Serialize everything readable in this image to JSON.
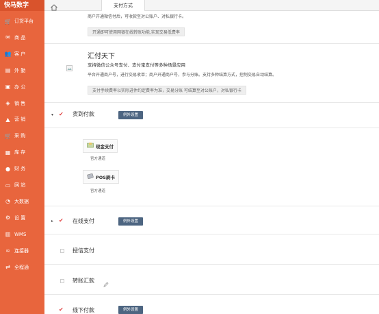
{
  "app": {
    "brand": "快马数字"
  },
  "sidebar": {
    "items": [
      {
        "label": "订货平台",
        "icon": "cart-icon"
      },
      {
        "label": "商 品",
        "icon": "mail-icon"
      },
      {
        "label": "客 户",
        "icon": "users-icon"
      },
      {
        "label": "外 勤",
        "icon": "document-icon"
      },
      {
        "label": "办 公",
        "icon": "briefcase-icon"
      },
      {
        "label": "销 售",
        "icon": "tag-icon"
      },
      {
        "label": "营 销",
        "icon": "chart-icon"
      },
      {
        "label": "采 购",
        "icon": "cart-icon"
      },
      {
        "label": "库 存",
        "icon": "box-icon"
      },
      {
        "label": "财 务",
        "icon": "money-bag-icon"
      },
      {
        "label": "网 站",
        "icon": "monitor-icon"
      },
      {
        "label": "大数据",
        "icon": "pie-chart-icon"
      },
      {
        "label": "设 置",
        "icon": "gear-icon"
      },
      {
        "label": "WMS",
        "icon": "warehouse-icon"
      },
      {
        "label": "连接器",
        "icon": "link-icon"
      },
      {
        "label": "全程通",
        "icon": "exchange-icon"
      }
    ]
  },
  "topbar": {
    "tab_label": "支付方式"
  },
  "top_section": {
    "desc": "商户开通微信付后，可收款至对公账户、对私银行卡。",
    "button": "开通即可使用网银在线转账功能,实现交易低费率"
  },
  "huifu": {
    "title": "汇付天下",
    "subtitle": "支持微信公众号支付、支付宝支付等多种场景应用",
    "desc": "平台开通商户号，进行交易收单；商户开通商户号，参与分账。支持多种结算方式，控制交易自动结算。",
    "button": "支付手续费率以实际进件约定费率为准，交易分账 可结算至对公账户，对私银行卡"
  },
  "methods": {
    "cod": {
      "label": "货到付款",
      "button": "例外设置",
      "checked": true
    },
    "cash": {
      "label": "现金支付",
      "caption": "官方通道"
    },
    "pos": {
      "label": "POS刷卡",
      "caption": "官方通道"
    },
    "online": {
      "label": "在线支付",
      "button": "例外设置",
      "checked": true
    },
    "credit": {
      "label": "授信支付",
      "checked": false
    },
    "transfer": {
      "label": "转账汇款",
      "checked": false
    },
    "offline": {
      "label": "线下付款",
      "button": "例外设置",
      "checked": true
    }
  },
  "colors": {
    "sidebar": "#e8653d",
    "sidebar_header": "#d9532c",
    "settings_button": "#4d6581",
    "checkmark": "#e04040"
  }
}
